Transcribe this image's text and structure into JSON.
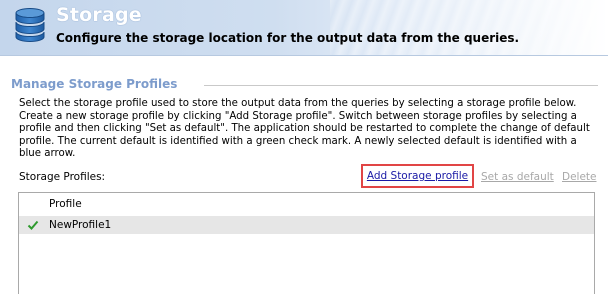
{
  "header": {
    "title": "Storage",
    "subtitle": "Configure the storage location for the output data from the queries.",
    "icon": "database-icon"
  },
  "section": {
    "title": "Manage Storage Profiles",
    "description": "Select the storage profile used to store the output data from the queries by selecting a storage profile below. Create a new storage profile by clicking \"Add Storage profile\". Switch between storage profiles by selecting a profile and then clicking \"Set as default\". The application should be restarted to complete the change of default profile. The current default is identified with a green check mark. A newly selected default is identified with a blue arrow."
  },
  "profiles": {
    "label": "Storage Profiles:",
    "actions": {
      "add": "Add Storage profile",
      "set_default": "Set as default",
      "delete": "Delete"
    },
    "column_header": "Profile",
    "rows": [
      {
        "name": "NewProfile1",
        "is_default": true,
        "marker_icon": "check-icon"
      }
    ]
  },
  "colors": {
    "section_title": "#7d9ccc",
    "link": "#1a1aa6",
    "disabled_link": "#a8a8a8",
    "highlight_border": "#e14545",
    "default_check": "#2e9a2e",
    "selected_row": "#e6e6e6"
  }
}
